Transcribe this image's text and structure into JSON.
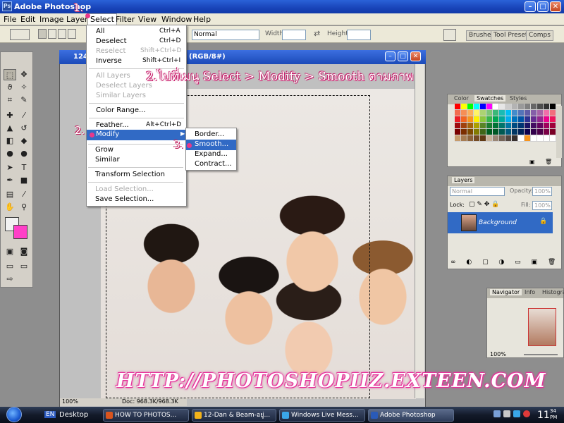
{
  "app": {
    "title": "Adobe Photoshop",
    "window_controls": [
      "minimize-icon",
      "maximize-icon",
      "close-icon"
    ]
  },
  "menubar": {
    "items": [
      "File",
      "Edit",
      "Image",
      "Layer",
      "Select",
      "Filter",
      "View",
      "Window",
      "Help"
    ],
    "active": "Select"
  },
  "options": {
    "mode_label": "Normal",
    "width_label": "Width:",
    "height_label": "Height:",
    "tabs": [
      "Brushes",
      "Tool Presets",
      "Comps"
    ]
  },
  "document": {
    "title_prefix": "124",
    "title_suffix": "(RGB/8#)",
    "zoom": "100%",
    "doc_size": "Doc: 968.3K/968.3K"
  },
  "select_menu": {
    "items": [
      {
        "label": "All",
        "shortcut": "Ctrl+A",
        "enabled": true
      },
      {
        "label": "Deselect",
        "shortcut": "Ctrl+D",
        "enabled": true
      },
      {
        "label": "Reselect",
        "shortcut": "Shift+Ctrl+D",
        "enabled": false
      },
      {
        "label": "Inverse",
        "shortcut": "Shift+Ctrl+I",
        "enabled": true
      },
      {
        "label": "All Layers",
        "shortcut": "",
        "enabled": false
      },
      {
        "label": "Deselect Layers",
        "shortcut": "",
        "enabled": false
      },
      {
        "label": "Similar Layers",
        "shortcut": "",
        "enabled": false
      },
      {
        "label": "Color Range...",
        "shortcut": "",
        "enabled": true
      },
      {
        "label": "Feather...",
        "shortcut": "Alt+Ctrl+D",
        "enabled": true
      },
      {
        "label": "Modify",
        "shortcut": "",
        "enabled": true,
        "submenu": true
      },
      {
        "label": "Grow",
        "shortcut": "",
        "enabled": true
      },
      {
        "label": "Similar",
        "shortcut": "",
        "enabled": true
      },
      {
        "label": "Transform Selection",
        "shortcut": "",
        "enabled": true
      },
      {
        "label": "Load Selection...",
        "shortcut": "",
        "enabled": false
      },
      {
        "label": "Save Selection...",
        "shortcut": "",
        "enabled": true
      }
    ],
    "highlighted": "Modify"
  },
  "modify_submenu": {
    "items": [
      "Border...",
      "Smooth...",
      "Expand...",
      "Contract..."
    ],
    "highlighted": "Smooth..."
  },
  "annotations": {
    "step1": "1.",
    "step2": "2.",
    "step3": "3.",
    "instruction": "2.ไปที่เมนู Select > Modify > Smooth ตามภาพ"
  },
  "color_panel": {
    "tabs": [
      "Color",
      "Swatches",
      "Styles"
    ],
    "active": "Swatches"
  },
  "swatch_colors": [
    "#ff0000",
    "#ffff00",
    "#00ff00",
    "#00ffff",
    "#0000ff",
    "#ff00ff",
    "#ffffff",
    "#e6e6e6",
    "#cccccc",
    "#b3b3b3",
    "#999999",
    "#808080",
    "#666666",
    "#4d4d4d",
    "#333333",
    "#000000",
    "#f26c4f",
    "#f68e55",
    "#fbaf5c",
    "#fff467",
    "#acd372",
    "#7cc576",
    "#3bb878",
    "#1abbb4",
    "#00bff3",
    "#438ccb",
    "#5574b9",
    "#605ca8",
    "#855fa8",
    "#a763a8",
    "#f06eaa",
    "#f26d7d",
    "#ed1c24",
    "#f26522",
    "#f7941d",
    "#fff200",
    "#8dc73f",
    "#39b54a",
    "#00a651",
    "#00a99d",
    "#00aeef",
    "#0072bc",
    "#0054a6",
    "#2e3192",
    "#662d91",
    "#92278f",
    "#ec008c",
    "#ed145b",
    "#9e0b0f",
    "#a0410d",
    "#a3620a",
    "#aba000",
    "#598527",
    "#1a7b30",
    "#007236",
    "#00746b",
    "#0076a3",
    "#004b80",
    "#003471",
    "#1b1464",
    "#440e62",
    "#630460",
    "#9e005d",
    "#9e0039",
    "#790000",
    "#7b2e00",
    "#7d4900",
    "#827b00",
    "#406618",
    "#005e20",
    "#005826",
    "#005952",
    "#005b7f",
    "#003663",
    "#002157",
    "#0d004c",
    "#32004b",
    "#4b0049",
    "#7b0046",
    "#7a0026",
    "#c69c6d",
    "#a67c52",
    "#8c6239",
    "#754c24",
    "#603913",
    "#c7b299",
    "#998675",
    "#736357",
    "#534741",
    "#362f2d",
    "#ffffff",
    "#f7941d",
    "#ffffff",
    "#ffffff",
    "#ffffff",
    "#ffffff"
  ],
  "layers_panel": {
    "tab": "Layers",
    "blend": "Normal",
    "opacity_label": "Opacity:",
    "opacity": "100%",
    "lock_label": "Lock:",
    "fill_label": "Fill:",
    "fill": "100%",
    "layer_name": "Background"
  },
  "navigator_panel": {
    "tabs": [
      "Navigator",
      "Info",
      "Histogra"
    ],
    "active": "Navigator",
    "zoom": "100%"
  },
  "watermark": "HTTP://PHOTOSHOPIIZ.EXTEEN.COM",
  "colors": {
    "foreground": "#f2f2f2",
    "background": "#ff40c8",
    "accent": "#316ac5"
  },
  "taskbar": {
    "lang": "EN",
    "desktop_label": "Desktop",
    "buttons": [
      {
        "label": "HOW TO PHOTOS...",
        "icon_color": "#d9541e"
      },
      {
        "label": "12-Dan & Beam-อยู่...",
        "icon_color": "#f2b21a"
      },
      {
        "label": "Windows Live Mess...",
        "icon_color": "#3aa6e8"
      },
      {
        "label": "Adobe Photoshop",
        "icon_color": "#2a5ab8"
      }
    ],
    "clock_hour": "11",
    "clock_min": "34",
    "clock_ampm": "PM"
  }
}
